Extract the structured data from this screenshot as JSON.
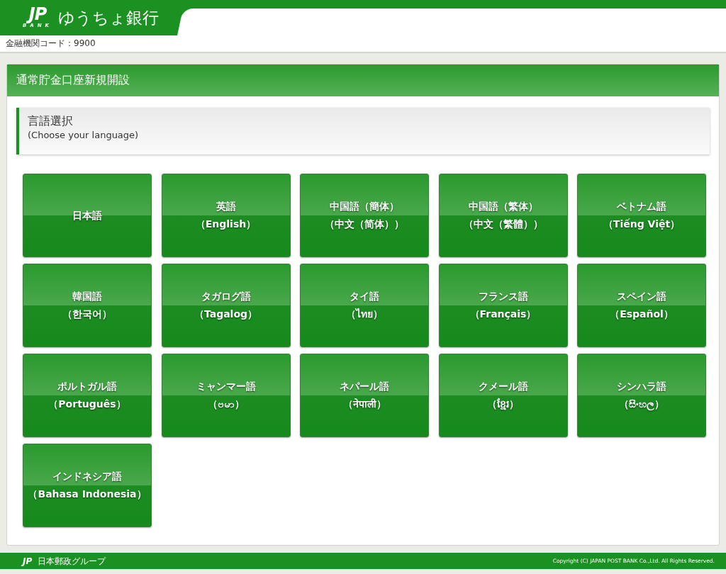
{
  "header": {
    "logo_mark": "JP",
    "logo_sub": "BANK",
    "bank_name": "ゆうちょ銀行",
    "institution_code": "金融機関コード：9900"
  },
  "panel": {
    "title": "通常貯金口座新規開設",
    "section": {
      "title": "言語選択",
      "subtitle": "(Choose your language)"
    },
    "languages": [
      {
        "lines": [
          "日本語"
        ]
      },
      {
        "lines": [
          "英語",
          "（English）"
        ]
      },
      {
        "lines": [
          "中国語（簡体）",
          "（中文（简体））"
        ]
      },
      {
        "lines": [
          "中国語（繁体）",
          "（中文（繁體））"
        ]
      },
      {
        "lines": [
          "ベトナム語",
          "（Tiếng Việt）"
        ]
      },
      {
        "lines": [
          "韓国語",
          "（한국어）"
        ]
      },
      {
        "lines": [
          "タガログ語",
          "（Tagalog）"
        ]
      },
      {
        "lines": [
          "タイ語",
          "（ไทย）"
        ]
      },
      {
        "lines": [
          "フランス語",
          "（Français）"
        ]
      },
      {
        "lines": [
          "スペイン語",
          "（Español）"
        ]
      },
      {
        "lines": [
          "ポルトガル語",
          "（Português）"
        ]
      },
      {
        "lines": [
          "ミャンマー語",
          "（ဗမာ）"
        ]
      },
      {
        "lines": [
          "ネパール語",
          "（नेपाली）"
        ]
      },
      {
        "lines": [
          "クメール語",
          "（ខ្មែរ）"
        ]
      },
      {
        "lines": [
          "シンハラ語",
          "（සිංහල）"
        ]
      },
      {
        "lines": [
          "インドネシア語",
          "（Bahasa Indonesia）"
        ]
      }
    ]
  },
  "footer": {
    "logo_mark": "JP",
    "group_name": "日本郵政グループ",
    "copyright": "Copyright (C) JAPAN POST BANK Co.,Ltd. All Rights Reserved."
  }
}
